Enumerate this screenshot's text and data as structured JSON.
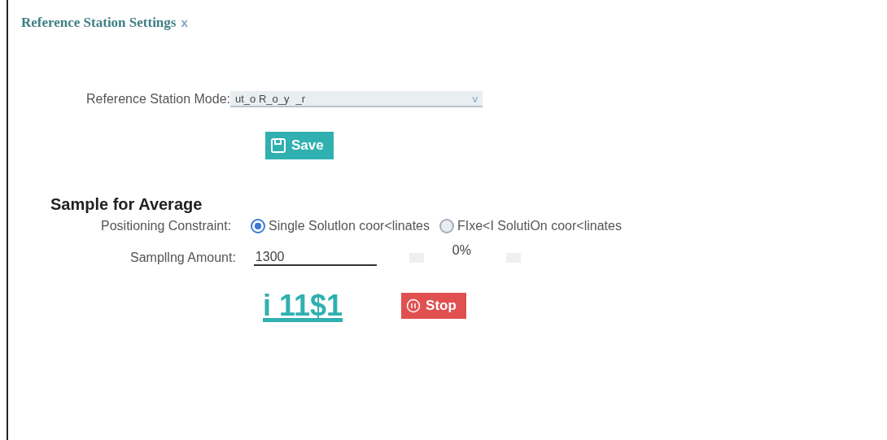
{
  "title": "Reference Station Settings",
  "close": "x",
  "mode": {
    "label": "Reference  Station Mode:",
    "value": "ut_o R_o_y",
    "value_2": "_r",
    "caret": "v"
  },
  "save_button": "Save",
  "section": "Sample for Average",
  "constraint": {
    "label": "Positioning Constraint:",
    "options": [
      {
        "label": "Single Solutlon coor<linates",
        "selected": true
      },
      {
        "label": "FIxe<I SolutiOn coor<linates",
        "selected": false
      }
    ]
  },
  "sampling": {
    "label": "Sampllng Amount:",
    "value": "1300",
    "progress": "0%"
  },
  "start_button": "i 11$1",
  "stop_button": "Stop"
}
